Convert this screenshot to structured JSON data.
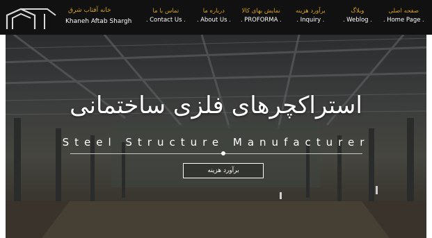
{
  "brand": {
    "name_fa": "خانه آفتاب شرق",
    "name_en": "Khaneh Aftab Shargh",
    "logo_icon": "house-roof-logo-icon"
  },
  "nav": {
    "items": [
      {
        "fa": "صفحه اصلی",
        "en": "Home Page"
      },
      {
        "fa": "وبلاگ",
        "en": "Weblog"
      },
      {
        "fa": "برآورد هزینه",
        "en": "Inquiry"
      },
      {
        "fa": "نمایش بهای کالا",
        "en": "PROFORMA"
      },
      {
        "fa": "درباره ما",
        "en": "About Us"
      },
      {
        "fa": "تماس با ما",
        "en": "Contact Us"
      }
    ]
  },
  "hero": {
    "title": "استراکچرهای فلزی ساختمانی",
    "subtitle": "Steel Structure Manufacturer",
    "button_label": "برآورد هزینه"
  },
  "colors": {
    "nav_bg": "#111111",
    "accent_gold": "#d4a017",
    "text_white": "#ffffff"
  }
}
